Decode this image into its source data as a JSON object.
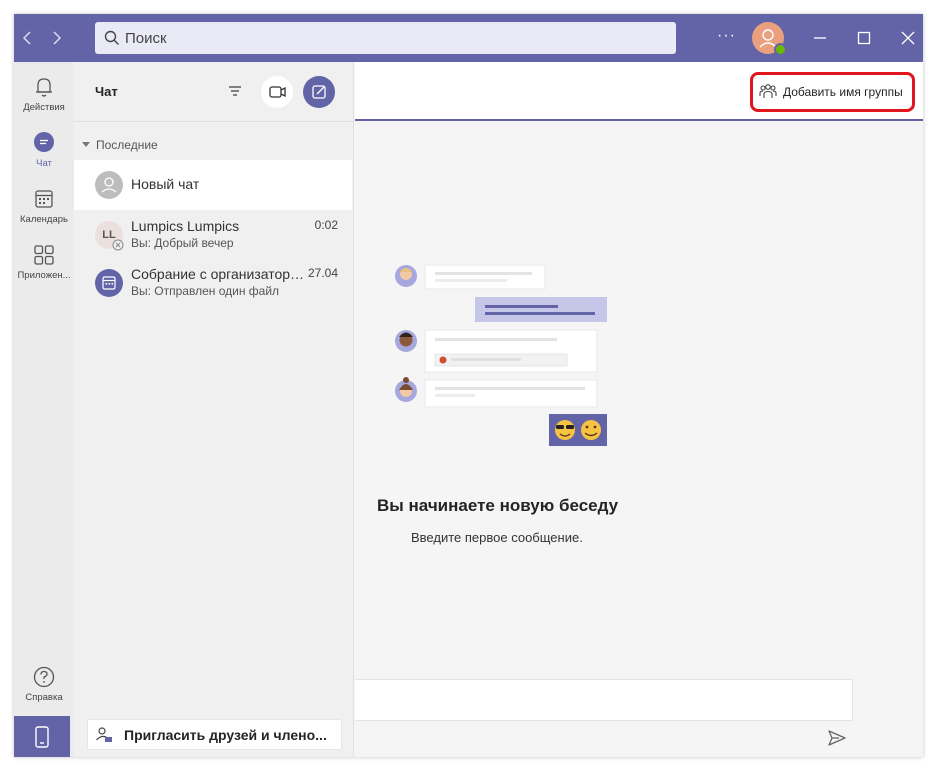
{
  "titlebar": {
    "back_icon": "chevron-left-icon",
    "forward_icon": "chevron-right-icon",
    "search_placeholder": "Поиск",
    "more_label": "···",
    "colors": {
      "bar": "#6264a7",
      "search_bg": "#e9eaf6",
      "presence": "#6bb700"
    }
  },
  "rail": {
    "items": [
      {
        "label": "Действия",
        "icon": "bell-icon"
      },
      {
        "label": "Чат",
        "icon": "chat-icon"
      },
      {
        "label": "Календарь",
        "icon": "calendar-icon"
      },
      {
        "label": "Приложен...",
        "icon": "apps-icon"
      }
    ],
    "help": {
      "label": "Справка",
      "icon": "help-icon"
    },
    "mobile_icon": "mobile-phone-icon"
  },
  "chatlist": {
    "title": "Чат",
    "section": "Последние",
    "items": [
      {
        "name": "Новый чат",
        "time": "",
        "sub": ""
      },
      {
        "name": "Lumpics Lumpics",
        "initials": "LL",
        "time": "0:02",
        "sub": "Вы: Добрый вечер"
      },
      {
        "name": "Собрание с организатором",
        "time": "27.04",
        "sub": "Вы: Отправлен один файл"
      }
    ],
    "invite": "Пригласить друзей и члено..."
  },
  "main": {
    "add_group_label": "Добавить имя группы",
    "welcome_title": "Вы начинаете новую беседу",
    "welcome_sub": "Введите первое сообщение.",
    "accent": "#6264a7",
    "highlight": "#e0161e"
  }
}
